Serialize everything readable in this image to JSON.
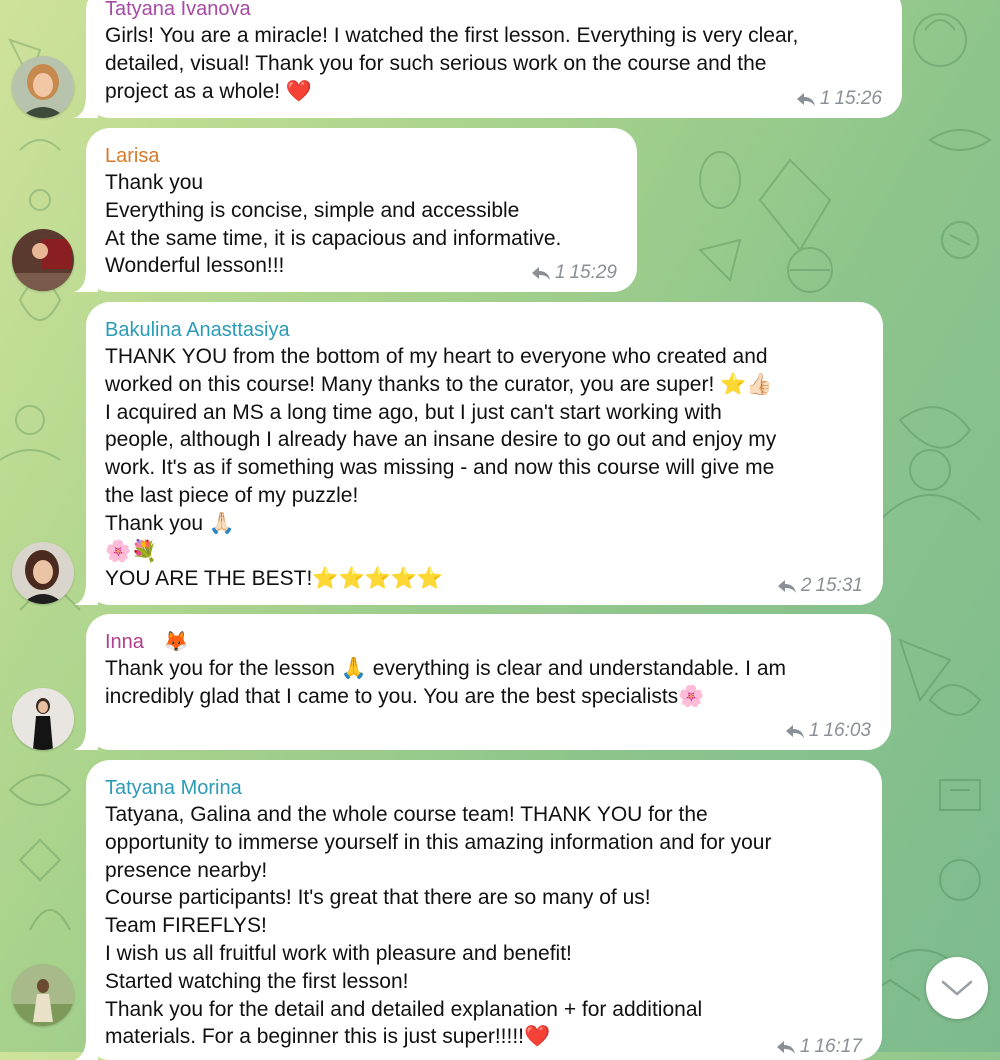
{
  "messages": [
    {
      "sender": "Tatyana Ivanova",
      "name_color": "#a64aa3",
      "lines": [
        "Girls! You are a miracle! I watched the first lesson. Everything is very clear,",
        "detailed, visual! Thank you for such serious work on the course and the",
        "project as a whole! ❤️"
      ],
      "reply_count": "1",
      "time": "15:26"
    },
    {
      "sender": "Larisa",
      "name_color": "#d97a2b",
      "lines": [
        "Thank you",
        "Everything is concise, simple and accessible",
        "At the same time, it is capacious and informative.",
        "Wonderful lesson!!!"
      ],
      "reply_count": "1",
      "time": "15:29"
    },
    {
      "sender": "Bakulina Anasttasiya",
      "name_color": "#2c9bb8",
      "lines": [
        "THANK YOU from the bottom of my heart to everyone who created and",
        "worked on this course! Many thanks to the curator, you are super! ⭐👍🏻",
        "I acquired an MS a long time ago, but I just can't start working with",
        "people, although I already have an insane desire to go out and enjoy my",
        "work. It's as if something was missing - and now this course will give me",
        "the last piece of my puzzle!",
        "Thank you 🙏🏻",
        "🌸💐",
        "YOU ARE THE BEST!⭐⭐⭐⭐⭐"
      ],
      "reply_count": "2",
      "time": "15:31"
    },
    {
      "sender": "Inna",
      "sender_emoji": "🦊",
      "name_color": "#b03f8d",
      "lines": [
        "Thank you for the lesson 🙏 everything is clear and understandable. I am",
        "incredibly glad that I came to you. You are the best specialists🌸"
      ],
      "reply_count": "1",
      "time": "16:03"
    },
    {
      "sender": "Tatyana Morina",
      "name_color": "#2c9bb8",
      "lines": [
        "Tatyana, Galina and the whole course team! THANK YOU for the",
        "opportunity to immerse yourself in this amazing information and for your",
        "presence nearby!",
        "Course participants! It's great that there are so many of us!",
        "Team FIREFLYS!",
        "I wish us all fruitful work with pleasure and benefit!",
        "Started watching the first lesson!",
        "Thank you for the detail and detailed explanation + for additional",
        "materials. For a beginner this is just super!!!!!❤️"
      ],
      "reply_count": "1",
      "time": "16:17"
    }
  ],
  "icons": {
    "reply": "reply-arrow-icon",
    "scroll_down": "chevron-down-icon"
  },
  "colors": {
    "bubble": "#ffffff",
    "meta": "#8a9096"
  }
}
